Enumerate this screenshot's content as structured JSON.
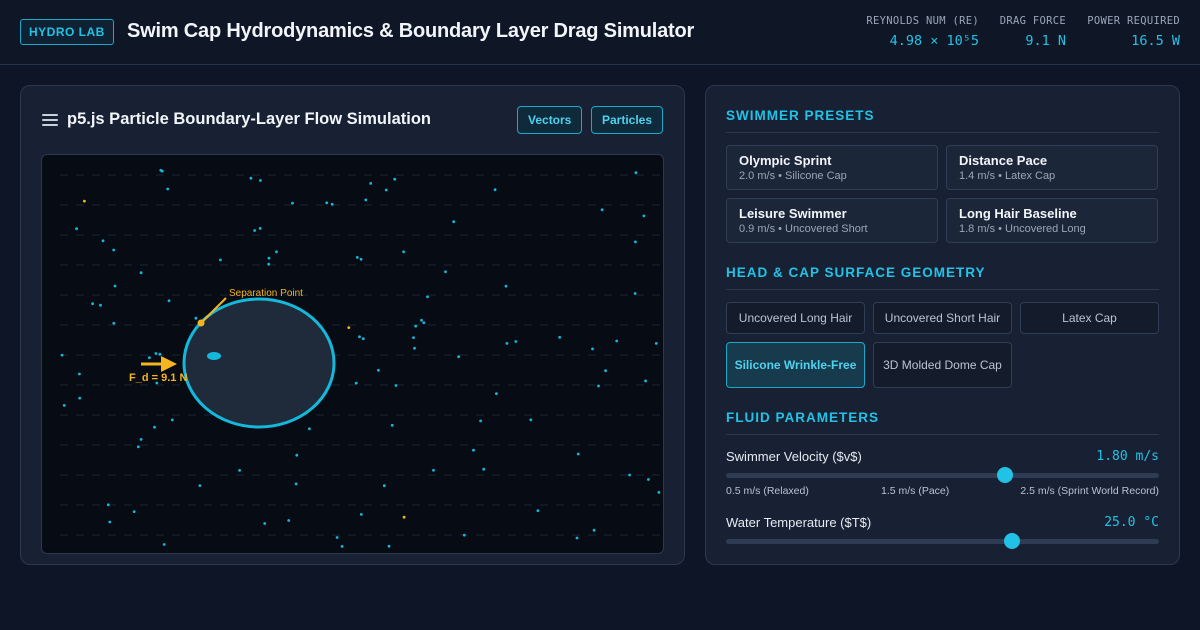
{
  "header": {
    "badge": "HYDRO LAB",
    "title": "Swim Cap Hydrodynamics & Boundary Layer Drag Simulator",
    "stats": [
      {
        "label": "REYNOLDS NUM (RE)",
        "value": "4.98 × 10⁵5"
      },
      {
        "label": "DRAG FORCE",
        "value": "9.1 N"
      },
      {
        "label": "POWER REQUIRED",
        "value": "16.5 W"
      }
    ]
  },
  "simulation": {
    "title": "p5.js Particle Boundary-Layer Flow Simulation",
    "buttons": [
      "Vectors",
      "Particles"
    ],
    "separation_label": "Separation Point",
    "force_label": "F_d = 9.1 N"
  },
  "presets": {
    "title": "SWIMMER PRESETS",
    "items": [
      {
        "name": "Olympic Sprint",
        "desc": "2.0 m/s • Silicone Cap"
      },
      {
        "name": "Distance Pace",
        "desc": "1.4 m/s • Latex Cap"
      },
      {
        "name": "Leisure Swimmer",
        "desc": "0.9 m/s • Uncovered Short"
      },
      {
        "name": "Long Hair Baseline",
        "desc": "1.8 m/s • Uncovered Long"
      }
    ]
  },
  "geometry": {
    "title": "HEAD & CAP SURFACE GEOMETRY",
    "options": [
      "Uncovered Long Hair",
      "Uncovered Short Hair",
      "Latex Cap",
      "Silicone Wrinkle-Free",
      "3D Molded Dome Cap"
    ],
    "selected": "Silicone Wrinkle-Free"
  },
  "fluid": {
    "title": "FLUID PARAMETERS",
    "velocity": {
      "label": "Swimmer Velocity ($v$)",
      "value_text": "1.80 m/s",
      "fraction": 0.645,
      "ticks": [
        "0.5 m/s (Relaxed)",
        "1.5 m/s (Pace)",
        "2.5 m/s (Sprint World Record)"
      ]
    },
    "temperature": {
      "label": "Water Temperature ($T$)",
      "value_text": "25.0 °C",
      "fraction": 0.66
    }
  },
  "colors": {
    "accent": "#22c2e6",
    "force": "#f5b51f",
    "background": "#0e1526"
  }
}
